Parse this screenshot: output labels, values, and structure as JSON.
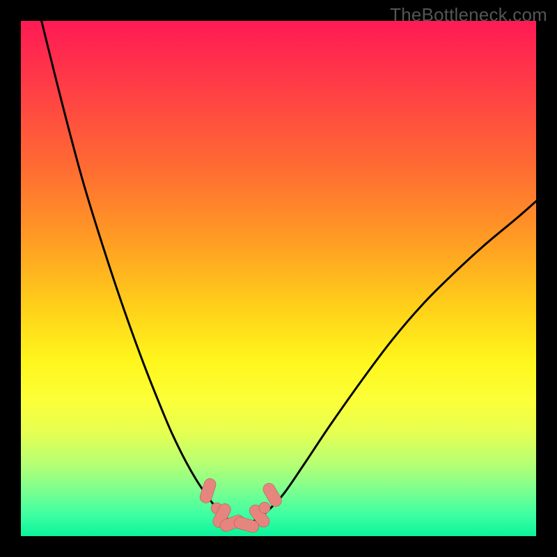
{
  "watermark": "TheBottleneck.com",
  "colors": {
    "frame_background": "#000000",
    "curve_stroke": "#000000",
    "marker_fill": "#e6857e",
    "marker_stroke": "#b85b56",
    "watermark_text": "#555555"
  },
  "chart_data": {
    "type": "line",
    "title": "",
    "xlabel": "",
    "ylabel": "",
    "xlim": [
      0,
      100
    ],
    "ylim": [
      0,
      100
    ],
    "grid": false,
    "legend": false,
    "series": [
      {
        "name": "left-branch",
        "x": [
          4,
          8,
          12,
          16,
          20,
          24,
          28,
          30,
          32,
          34,
          36,
          37.5,
          39,
          40.5
        ],
        "y": [
          100,
          84,
          69,
          56,
          44,
          33,
          23,
          18.5,
          14.5,
          11,
          8,
          6,
          4.3,
          3
        ]
      },
      {
        "name": "right-branch",
        "x": [
          46,
          48,
          51,
          55,
          60,
          66,
          72,
          78,
          84,
          90,
          96,
          100
        ],
        "y": [
          3.4,
          5,
          8.2,
          14,
          21.5,
          30,
          38,
          45,
          51,
          56.5,
          61.5,
          65
        ]
      },
      {
        "name": "valley-floor",
        "x": [
          40.5,
          41.5,
          43,
          44.5,
          46
        ],
        "y": [
          3,
          2.4,
          2.2,
          2.6,
          3.4
        ]
      }
    ],
    "markers": [
      {
        "x": 36.3,
        "y": 8.8,
        "shape": "pill",
        "angle": -72
      },
      {
        "x": 38.0,
        "y": 5.4,
        "shape": "dot"
      },
      {
        "x": 39.0,
        "y": 4.0,
        "shape": "pill",
        "angle": -63
      },
      {
        "x": 41.0,
        "y": 2.5,
        "shape": "pill",
        "angle": -20
      },
      {
        "x": 43.8,
        "y": 2.2,
        "shape": "pill",
        "angle": 15
      },
      {
        "x": 46.3,
        "y": 3.9,
        "shape": "pill",
        "angle": 52
      },
      {
        "x": 47.3,
        "y": 5.5,
        "shape": "dot"
      },
      {
        "x": 48.8,
        "y": 8.0,
        "shape": "pill",
        "angle": 60
      }
    ]
  }
}
